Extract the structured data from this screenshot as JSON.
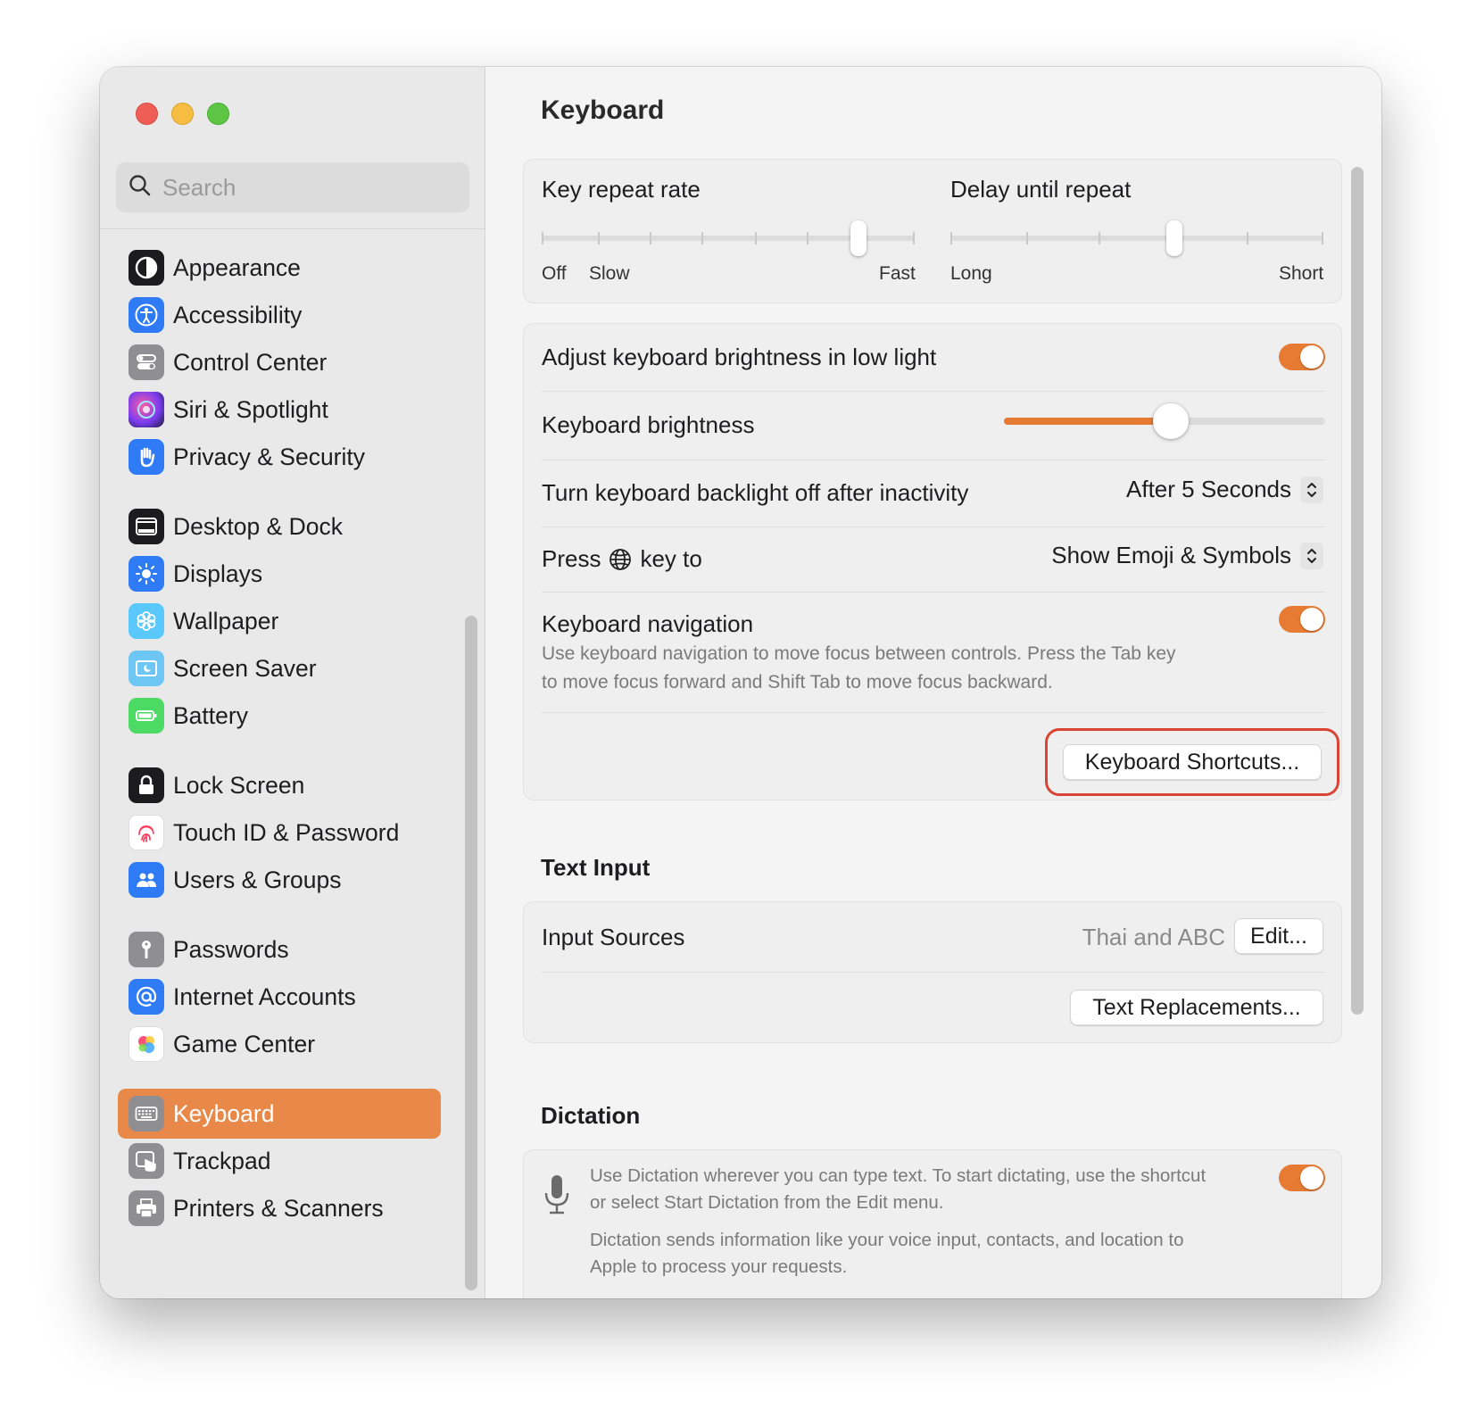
{
  "search": {
    "placeholder": "Search"
  },
  "sidebar": {
    "items": [
      {
        "label": "Appearance"
      },
      {
        "label": "Accessibility"
      },
      {
        "label": "Control Center"
      },
      {
        "label": "Siri & Spotlight"
      },
      {
        "label": "Privacy & Security"
      },
      {
        "label": "Desktop & Dock"
      },
      {
        "label": "Displays"
      },
      {
        "label": "Wallpaper"
      },
      {
        "label": "Screen Saver"
      },
      {
        "label": "Battery"
      },
      {
        "label": "Lock Screen"
      },
      {
        "label": "Touch ID & Password"
      },
      {
        "label": "Users & Groups"
      },
      {
        "label": "Passwords"
      },
      {
        "label": "Internet Accounts"
      },
      {
        "label": "Game Center"
      },
      {
        "label": "Keyboard"
      },
      {
        "label": "Trackpad"
      },
      {
        "label": "Printers & Scanners"
      }
    ],
    "selected": "Keyboard"
  },
  "page": {
    "title": "Keyboard"
  },
  "key_repeat": {
    "label": "Key repeat rate",
    "min_label": "Off",
    "slow_label": "Slow",
    "max_label": "Fast",
    "level_fraction": 0.85
  },
  "delay_repeat": {
    "label": "Delay until repeat",
    "min_label": "Long",
    "max_label": "Short",
    "level_fraction": 0.6
  },
  "brightness": {
    "adjust_label": "Adjust keyboard brightness in low light",
    "adjust_on": true,
    "brightness_label": "Keyboard brightness",
    "brightness_fraction": 0.52,
    "backlight_label": "Turn keyboard backlight off after inactivity",
    "backlight_value": "After 5 Seconds",
    "press_prefix": "Press",
    "press_suffix": "key to",
    "press_value": "Show Emoji & Symbols",
    "nav_label": "Keyboard navigation",
    "nav_on": true,
    "nav_desc_1": "Use keyboard navigation to move focus between controls. Press the Tab key",
    "nav_desc_2": "to move focus forward and Shift Tab to move focus backward.",
    "shortcuts_button": "Keyboard Shortcuts..."
  },
  "text_input": {
    "title": "Text Input",
    "sources_label": "Input Sources",
    "sources_value": "Thai and ABC",
    "edit_button": "Edit...",
    "replacements_button": "Text Replacements..."
  },
  "dictation": {
    "title": "Dictation",
    "desc_1": "Use Dictation wherever you can type text. To start dictating, use the shortcut",
    "desc_2": "or select Start Dictation from the Edit menu.",
    "desc_3": "Dictation sends information like your voice input, contacts, and location to",
    "desc_4": "Apple to process your requests.",
    "enabled": true
  },
  "colors": {
    "accent": "#e77b34",
    "selection": "#e8894a",
    "highlight_ring": "#d84535"
  }
}
